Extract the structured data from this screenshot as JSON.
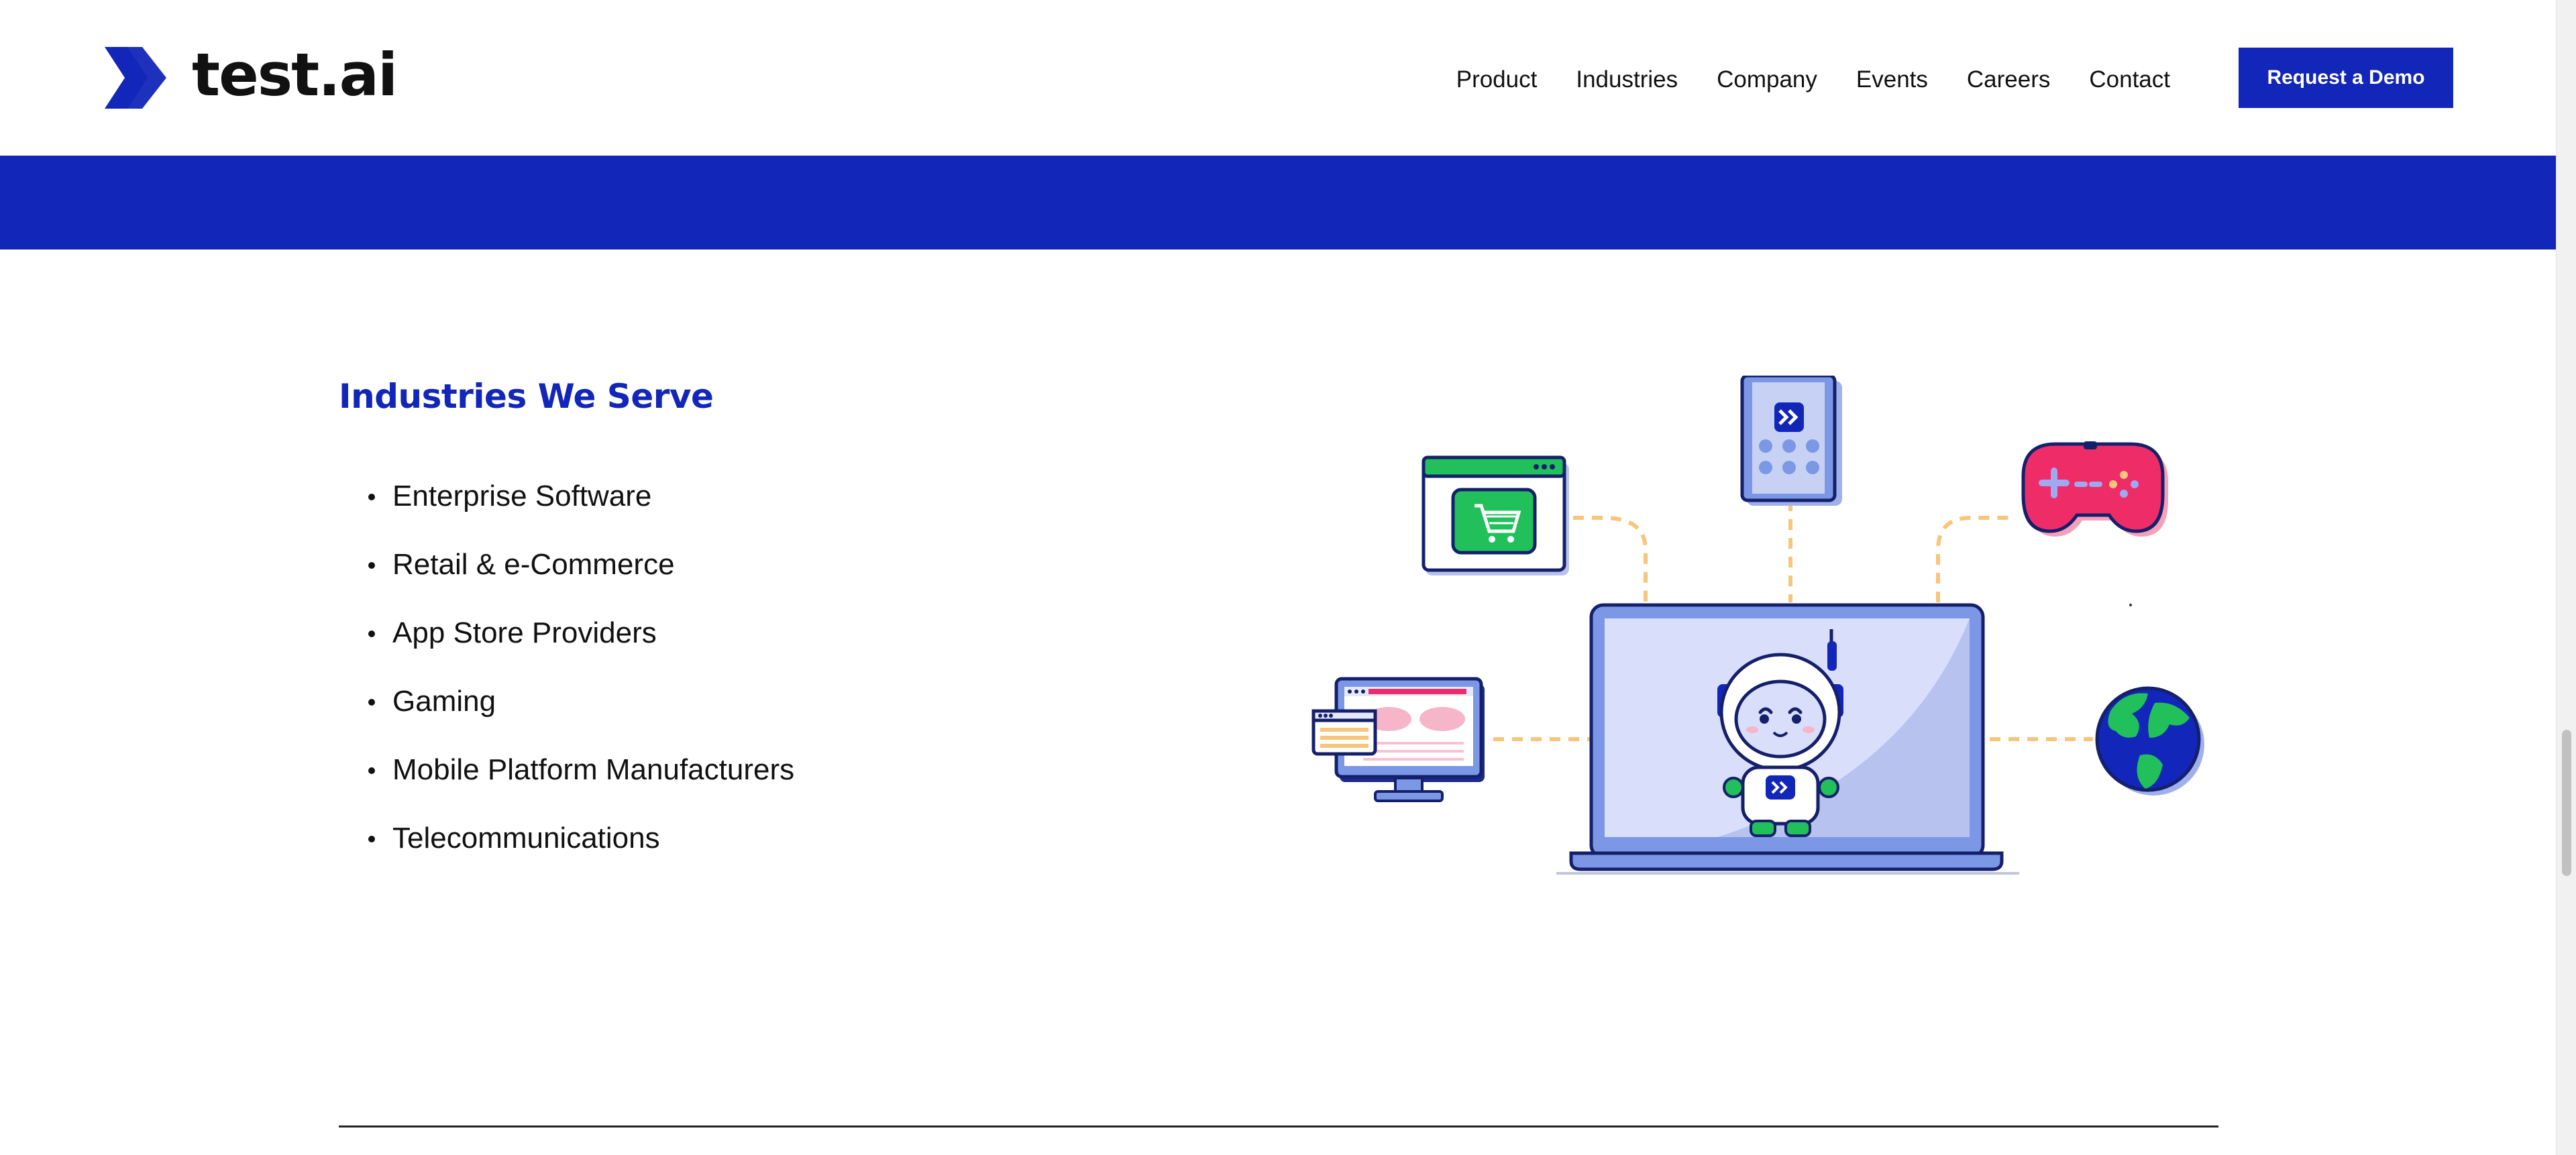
{
  "brand": {
    "name": "test.ai"
  },
  "nav": {
    "items": [
      "Product",
      "Industries",
      "Company",
      "Events",
      "Careers",
      "Contact"
    ],
    "cta_label": "Request a Demo"
  },
  "content": {
    "title": "Industries We Serve",
    "industries": [
      "Enterprise Software",
      "Retail & e-Commerce",
      "App Store Providers",
      "Gaming",
      "Mobile Platform Manufacturers",
      "Telecommunications"
    ]
  },
  "colors": {
    "brand_blue": "#1226b9",
    "laptop": "#7b97e6",
    "cart_green": "#21c05a",
    "gamepad": "#ee2c67",
    "connector": "#f9c47b"
  },
  "icons": [
    "cart-window-icon",
    "phone-icon",
    "gamepad-icon",
    "monitor-icon",
    "laptop-icon",
    "robot-mascot-icon",
    "globe-icon"
  ]
}
